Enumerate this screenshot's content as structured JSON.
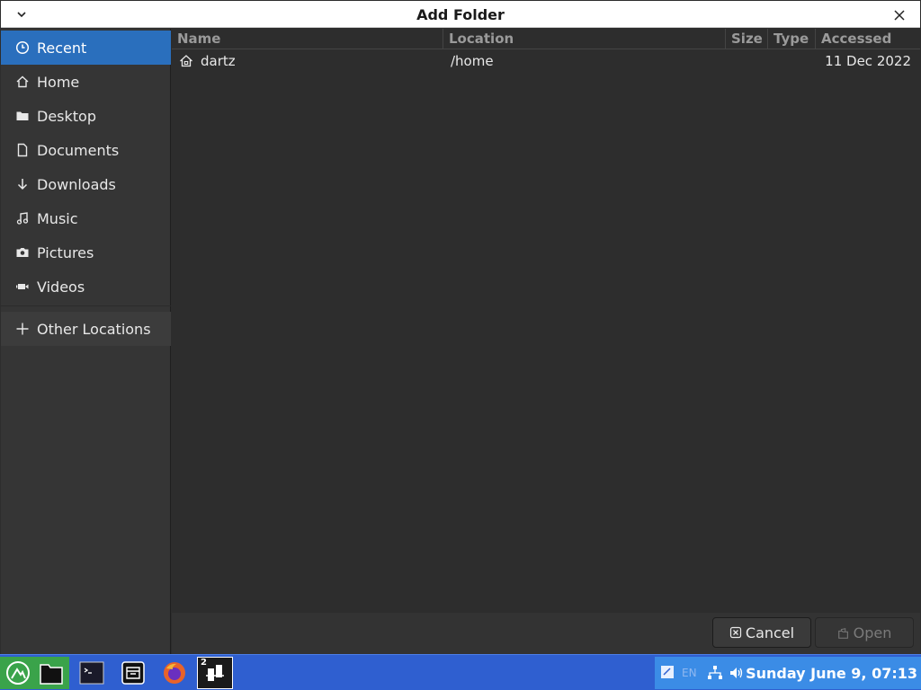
{
  "dialog": {
    "title": "Add Folder"
  },
  "sidebar": {
    "items": [
      {
        "label": "Recent",
        "icon": "clock-icon",
        "active": true
      },
      {
        "label": "Home",
        "icon": "home-icon"
      },
      {
        "label": "Desktop",
        "icon": "folder-icon"
      },
      {
        "label": "Documents",
        "icon": "document-icon"
      },
      {
        "label": "Downloads",
        "icon": "download-icon"
      },
      {
        "label": "Music",
        "icon": "music-icon"
      },
      {
        "label": "Pictures",
        "icon": "camera-icon"
      },
      {
        "label": "Videos",
        "icon": "video-icon"
      }
    ],
    "other_locations": "Other Locations"
  },
  "table": {
    "columns": [
      "Name",
      "Location",
      "Size",
      "Type",
      "Accessed"
    ],
    "rows": [
      {
        "name": "dartz",
        "location": "/home",
        "size": "",
        "type": "",
        "accessed": "11 Dec 2022",
        "icon": "home-icon"
      }
    ]
  },
  "footer": {
    "cancel_label": "Cancel",
    "open_label": "Open"
  },
  "taskbar": {
    "workspace_badge": "2",
    "lang": "EN",
    "clock": "Sunday June  9, 07:13",
    "apps": [
      "start-menu-icon",
      "files-icon",
      "terminal-icon",
      "archive-icon",
      "firefox-icon",
      "app-switcher-icon"
    ]
  },
  "colors": {
    "accent": "#2a6fbd",
    "taskbar": "#2f5fd0",
    "tray": "#3b8ce6"
  }
}
